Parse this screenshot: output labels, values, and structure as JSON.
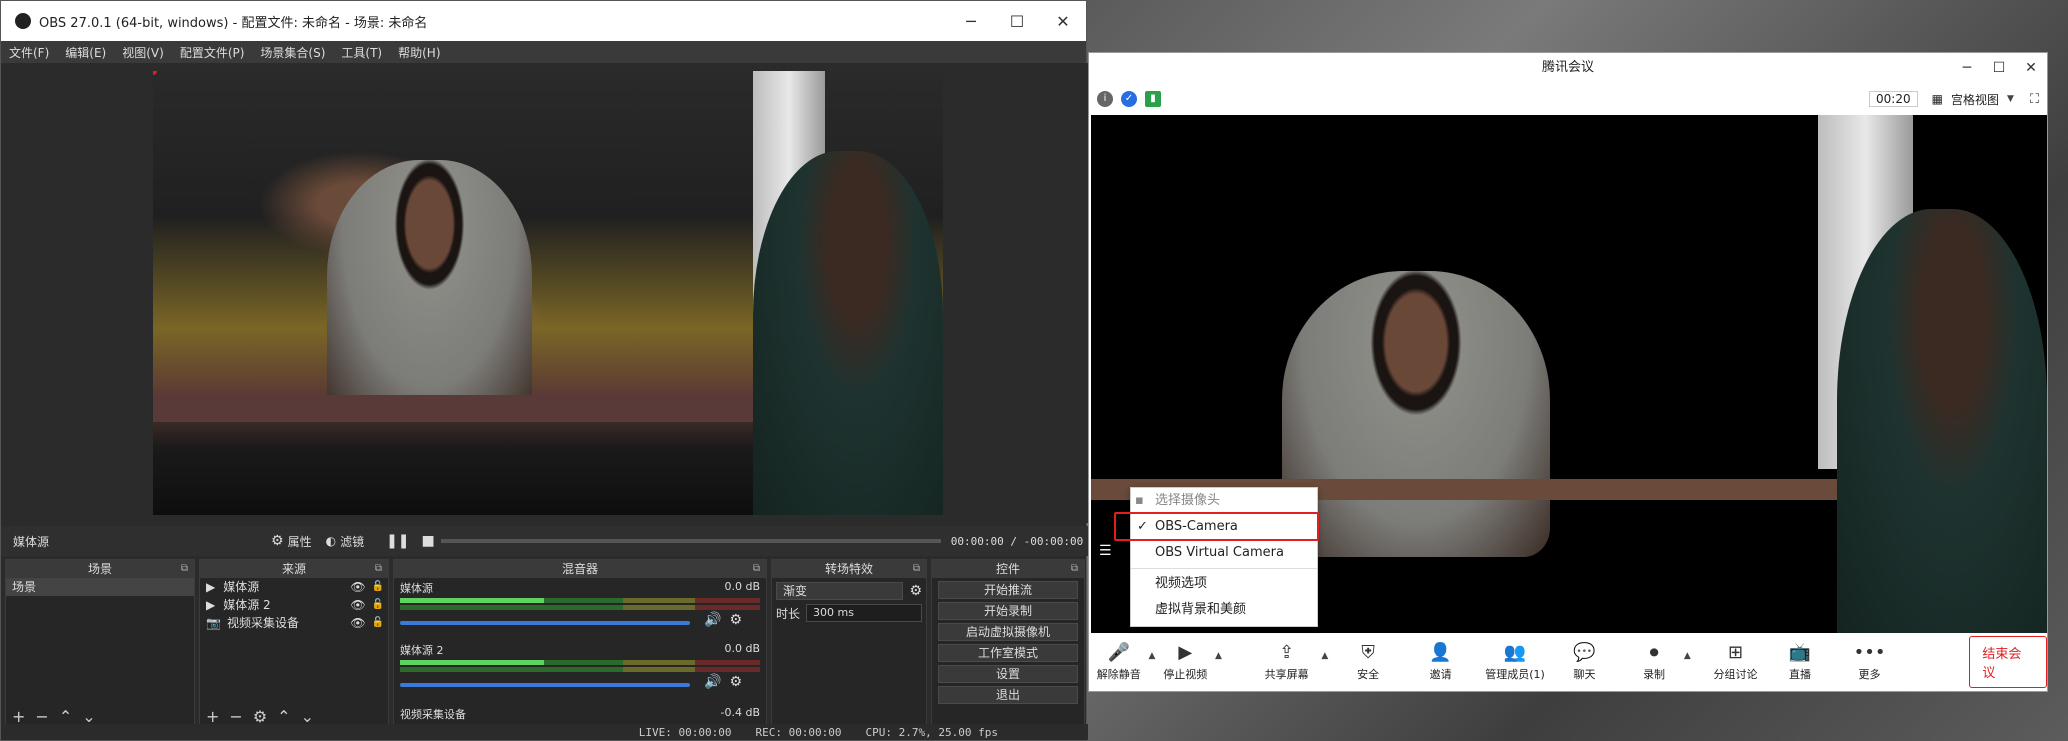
{
  "obs": {
    "title": "OBS 27.0.1 (64-bit, windows) - 配置文件: 未命名 - 场景: 未命名",
    "menus": [
      "文件(F)",
      "编辑(E)",
      "视图(V)",
      "配置文件(P)",
      "场景集合(S)",
      "工具(T)",
      "帮助(H)"
    ],
    "source_label": "媒体源",
    "properties": "属性",
    "filters": "滤镜",
    "time": "00:00:00 / -00:00:00",
    "panels": {
      "scenes": "场景",
      "sources": "来源",
      "mixer": "混音器",
      "transitions": "转场特效",
      "controls": "控件"
    },
    "scenes": [
      "场景"
    ],
    "sources": [
      "媒体源",
      "媒体源 2",
      "视频采集设备"
    ],
    "mixer": [
      {
        "name": "媒体源",
        "db": "0.0 dB"
      },
      {
        "name": "媒体源 2",
        "db": "0.0 dB"
      },
      {
        "name": "视频采集设备",
        "db": "-0.4 dB"
      }
    ],
    "transition": {
      "value": "渐变",
      "duration_label": "时长",
      "duration": "300 ms"
    },
    "controls": [
      "开始推流",
      "开始录制",
      "启动虚拟摄像机",
      "工作室模式",
      "设置",
      "退出"
    ],
    "status": {
      "live": "LIVE: 00:00:00",
      "rec": "REC: 00:00:00",
      "cpu": "CPU: 2.7%, 25.00 fps"
    }
  },
  "tencent": {
    "title": "腾讯会议",
    "timer": "00:20",
    "view_mode": "宫格视图",
    "camera_menu": {
      "header": "选择摄像头",
      "items": [
        "OBS-Camera",
        "OBS Virtual Camera"
      ],
      "selected": "OBS-Camera",
      "options": [
        "视频选项",
        "虚拟背景和美颜"
      ]
    },
    "toolbar": [
      "解除静音",
      "停止视频",
      "共享屏幕",
      "安全",
      "邀请",
      "管理成员(1)",
      "聊天",
      "录制",
      "分组讨论",
      "直播",
      "更多"
    ],
    "end_button": "结束会议"
  },
  "colors": {
    "highlight": "#e02020",
    "end_button": "#e02020"
  }
}
